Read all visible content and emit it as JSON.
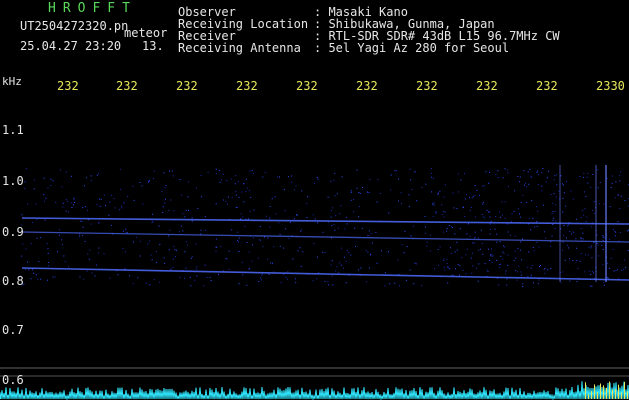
{
  "header": {
    "brand": "HROFFT",
    "filename": "UT2504272320.pn",
    "overlay_label": "meteor",
    "datetime": "25.04.27 23:20",
    "count": "13.",
    "fields": [
      {
        "label": "Observer",
        "value": ": Masaki Kano"
      },
      {
        "label": "Receiving Location",
        "value": ": Shibukawa, Gunma, Japan"
      },
      {
        "label": "Receiver",
        "value": ": RTL-SDR SDR# 43dB L15 96.7MHz CW"
      },
      {
        "label": "Receiving Antenna",
        "value": ": 5el Yagi Az 280 for Seoul"
      }
    ]
  },
  "chart_data": {
    "type": "heatmap",
    "ylabel": "kHz",
    "y_ticks": [
      "1.1",
      "1.0",
      "0.9",
      "0.8",
      "0.7",
      "0.6"
    ],
    "x_ticks": [
      "232",
      "232",
      "232",
      "232",
      "232",
      "232",
      "232",
      "232",
      "232",
      "2330"
    ],
    "ylim": [
      0.58,
      1.15
    ],
    "signal_lines_khz": [
      0.92,
      0.9,
      0.82
    ],
    "grid": false
  },
  "colors": {
    "background": "#000000",
    "signal": "#3a5cff",
    "text_green": "#5ad85a",
    "text_yellow": "#e8e85a",
    "amplitude": "#30e8ff"
  }
}
